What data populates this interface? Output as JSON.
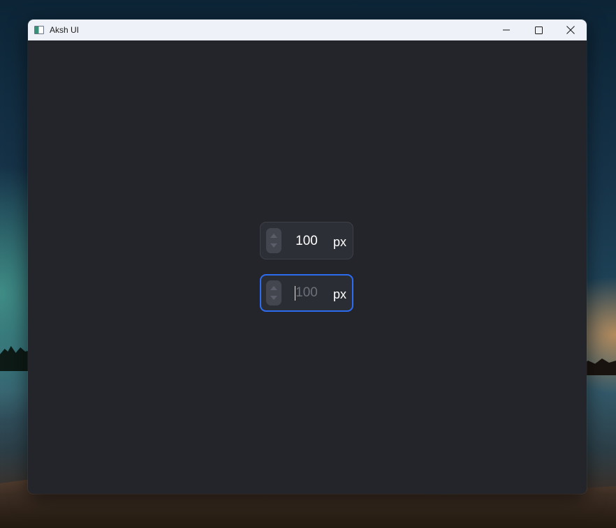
{
  "window": {
    "title": "Aksh UI",
    "controls": {
      "minimize_icon": "minimize-icon",
      "maximize_icon": "maximize-icon",
      "close_icon": "close-icon"
    }
  },
  "fields": [
    {
      "value": "100",
      "placeholder": "",
      "unit": "px",
      "focused": false
    },
    {
      "value": "",
      "placeholder": "100",
      "unit": "px",
      "focused": true
    }
  ],
  "colors": {
    "accent_focus": "#2d6cf0",
    "client_background": "#24252b",
    "field_background": "#2d2f37",
    "titlebar_background": "#eef2f8"
  }
}
